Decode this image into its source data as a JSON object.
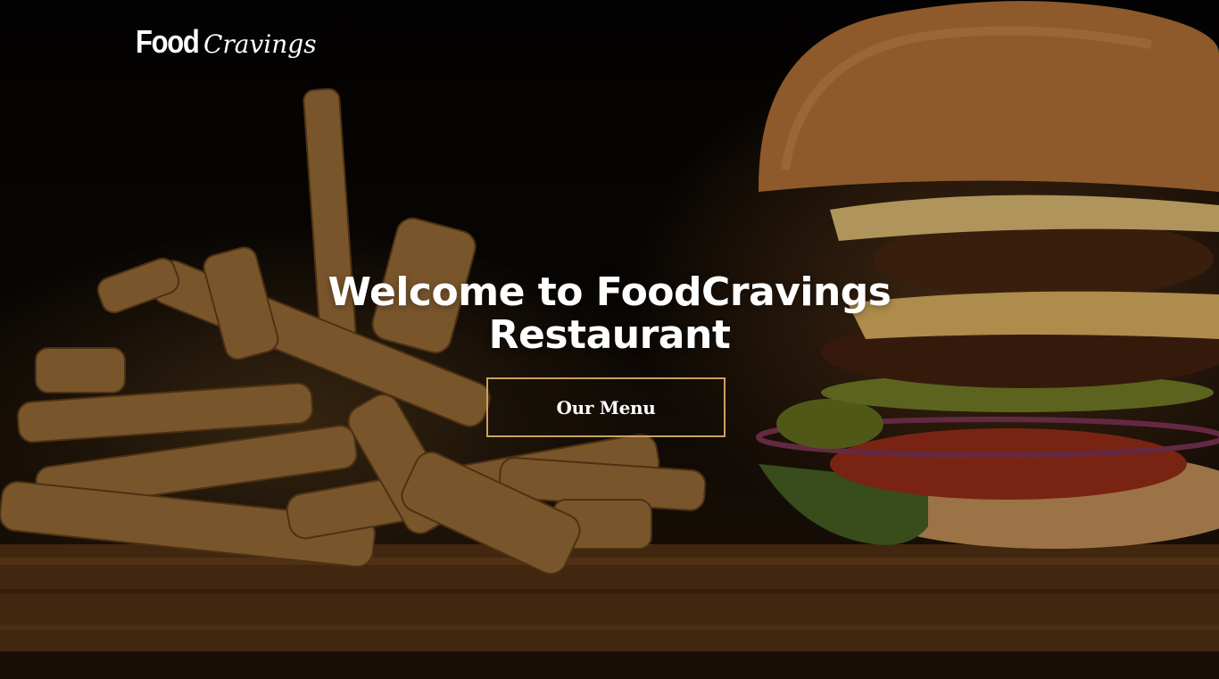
{
  "brand": {
    "logo_food": "Food",
    "logo_cravings": "Cravings"
  },
  "hero": {
    "headline_line1": "Welcome to FoodCravings",
    "headline_line2": "Restaurant",
    "menu_button_label": "Our Menu",
    "background_image": "burger-and-fries-photo"
  },
  "colors": {
    "button_border": "#c9a35f",
    "text": "#ffffff",
    "background": "#0a0806"
  }
}
